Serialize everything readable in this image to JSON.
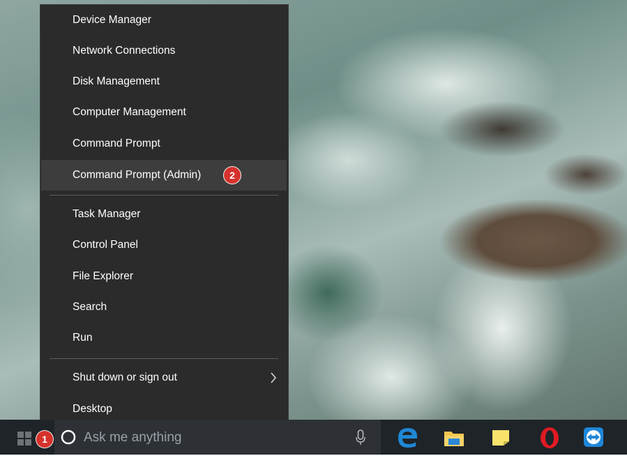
{
  "menu": {
    "items": [
      {
        "label": "Device Manager"
      },
      {
        "label": "Network Connections"
      },
      {
        "label": "Disk Management"
      },
      {
        "label": "Computer Management"
      },
      {
        "label": "Command Prompt"
      },
      {
        "label": "Command Prompt (Admin)",
        "highlighted": true
      },
      {
        "label": "Task Manager"
      },
      {
        "label": "Control Panel"
      },
      {
        "label": "File Explorer"
      },
      {
        "label": "Search"
      },
      {
        "label": "Run"
      },
      {
        "label": "Shut down or sign out",
        "has_submenu": true
      },
      {
        "label": "Desktop"
      }
    ]
  },
  "annotations": {
    "step1": "1",
    "step2": "2",
    "color": "#d6322d"
  },
  "taskbar": {
    "search_placeholder": "Ask me anything",
    "icons": [
      "windows-start-icon",
      "cortana-circle-icon",
      "microphone-icon",
      "edge-browser-icon",
      "file-explorer-icon",
      "sticky-notes-icon",
      "opera-browser-icon",
      "teamviewer-icon"
    ]
  },
  "colors": {
    "menu_bg": "#2b2b2b",
    "menu_highlight": "#3d3d3d",
    "taskbar_bg": "#1f2429",
    "edge_blue": "#1e88d6",
    "opera_red": "#e11a22"
  }
}
